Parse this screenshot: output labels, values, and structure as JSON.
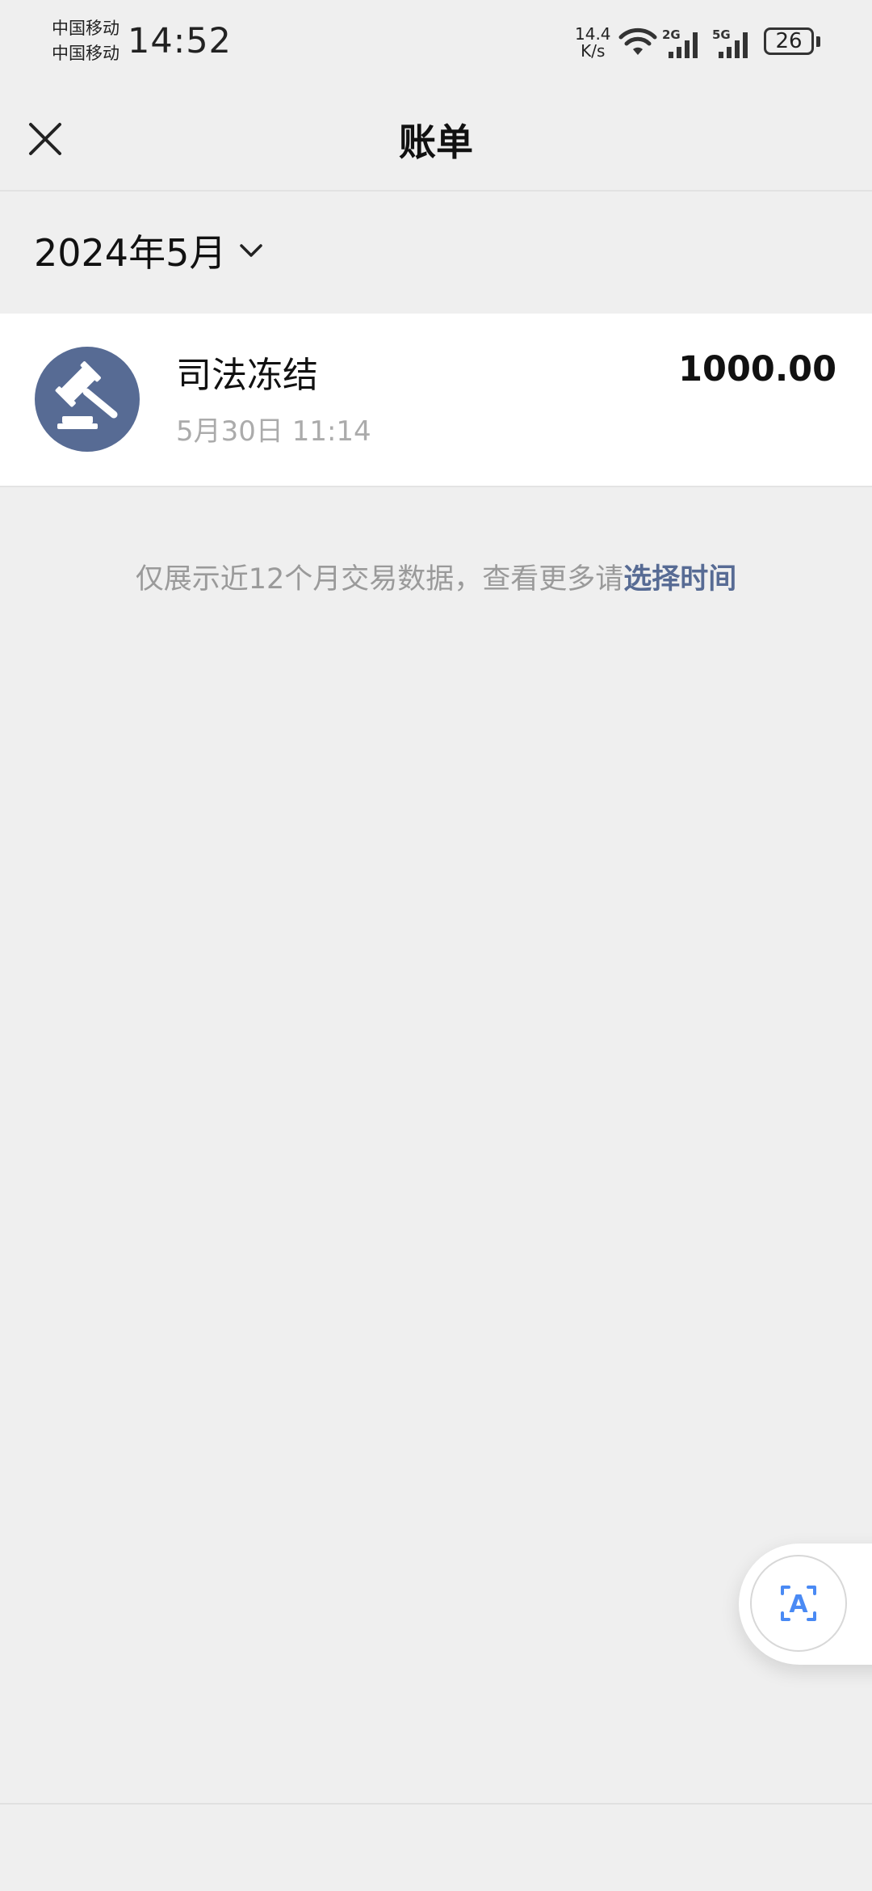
{
  "status_bar": {
    "carrier_1": "中国移动",
    "carrier_2": "中国移动",
    "time": "14:52",
    "net_speed_value": "14.4",
    "net_speed_unit": "K/s",
    "signal_1_label": "2G",
    "signal_2_label": "5G",
    "battery": "26",
    "icons": [
      "wifi-icon",
      "signal-2g-icon",
      "signal-5g-icon",
      "battery-icon"
    ]
  },
  "header": {
    "title": "账单",
    "close_icon": "close-icon"
  },
  "month_selector": {
    "label": "2024年5月",
    "icon": "chevron-down-icon"
  },
  "transactions": [
    {
      "title": "司法冻结",
      "time": "5月30日 11:14",
      "amount": "1000.00",
      "icon": "gavel-icon",
      "icon_bg": "#576b94"
    }
  ],
  "footer_hint": {
    "text": "仅展示近12个月交易数据，查看更多请",
    "link": "选择时间",
    "link_color": "#576b94"
  },
  "floating_button": {
    "icon": "text-scan-icon",
    "glyph": "A",
    "accent": "#4a8af4"
  }
}
